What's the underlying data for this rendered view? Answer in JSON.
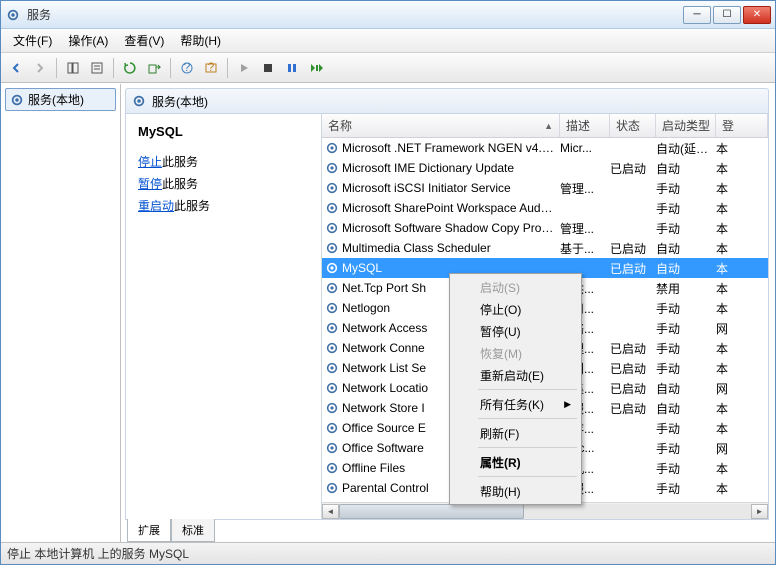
{
  "window": {
    "title": "服务"
  },
  "menu": {
    "file": "文件(F)",
    "action": "操作(A)",
    "view": "查看(V)",
    "help": "帮助(H)"
  },
  "tree": {
    "root": "服务(本地)"
  },
  "panel": {
    "heading": "服务(本地)"
  },
  "detail": {
    "title": "MySQL",
    "stop_pre": "停止",
    "stop_post": "此服务",
    "pause_pre": "暂停",
    "pause_post": "此服务",
    "restart_pre": "重启动",
    "restart_post": "此服务"
  },
  "columns": {
    "name": "名称",
    "desc": "描述",
    "status": "状态",
    "startup": "启动类型",
    "logon": "登"
  },
  "services": [
    {
      "name": "Microsoft .NET Framework NGEN v4.0....",
      "desc": "Micr...",
      "status": "",
      "startup": "自动(延迟...",
      "logon": "本"
    },
    {
      "name": "Microsoft IME Dictionary Update",
      "desc": "",
      "status": "已启动",
      "startup": "自动",
      "logon": "本"
    },
    {
      "name": "Microsoft iSCSI Initiator Service",
      "desc": "管理...",
      "status": "",
      "startup": "手动",
      "logon": "本"
    },
    {
      "name": "Microsoft SharePoint Workspace Audit...",
      "desc": "",
      "status": "",
      "startup": "手动",
      "logon": "本"
    },
    {
      "name": "Microsoft Software Shadow Copy Prov...",
      "desc": "管理...",
      "status": "",
      "startup": "手动",
      "logon": "本"
    },
    {
      "name": "Multimedia Class Scheduler",
      "desc": "基于...",
      "status": "已启动",
      "startup": "自动",
      "logon": "本"
    },
    {
      "name": "MySQL",
      "desc": "",
      "status": "已启动",
      "startup": "自动",
      "logon": "本",
      "selected": true
    },
    {
      "name": "Net.Tcp Port Sh",
      "desc_r": "提供...",
      "status": "",
      "startup": "禁用",
      "logon": "本"
    },
    {
      "name": "Netlogon",
      "desc_r": "为用...",
      "status": "",
      "startup": "手动",
      "logon": "本"
    },
    {
      "name": "Network Access",
      "desc_r": "网络...",
      "status": "",
      "startup": "手动",
      "logon": "网"
    },
    {
      "name": "Network Conne",
      "desc_r": "管理...",
      "status": "已启动",
      "startup": "手动",
      "logon": "本"
    },
    {
      "name": "Network List Se",
      "desc_r": "识别...",
      "status": "已启动",
      "startup": "手动",
      "logon": "本"
    },
    {
      "name": "Network Locatio",
      "desc_r": "收集...",
      "status": "已启动",
      "startup": "自动",
      "logon": "网"
    },
    {
      "name": "Network Store I",
      "desc_r": "此服...",
      "status": "已启动",
      "startup": "自动",
      "logon": "本"
    },
    {
      "name": "Office  Source E",
      "desc_r": "保存...",
      "status": "",
      "startup": "手动",
      "logon": "本"
    },
    {
      "name": "Office Software",
      "desc_r": "Offic...",
      "status": "",
      "startup": "手动",
      "logon": "网"
    },
    {
      "name": "Offline Files",
      "desc_r": "脱机...",
      "status": "",
      "startup": "手动",
      "logon": "本"
    },
    {
      "name": "Parental Control",
      "desc_r": "此服...",
      "status": "",
      "startup": "手动",
      "logon": "本"
    }
  ],
  "context": {
    "start": "启动(S)",
    "stop": "停止(O)",
    "pause": "暂停(U)",
    "resume": "恢复(M)",
    "restart": "重新启动(E)",
    "alltasks": "所有任务(K)",
    "refresh": "刷新(F)",
    "properties": "属性(R)",
    "help": "帮助(H)"
  },
  "tabs": {
    "extended": "扩展",
    "standard": "标准"
  },
  "status_text": "停止 本地计算机 上的服务 MySQL"
}
